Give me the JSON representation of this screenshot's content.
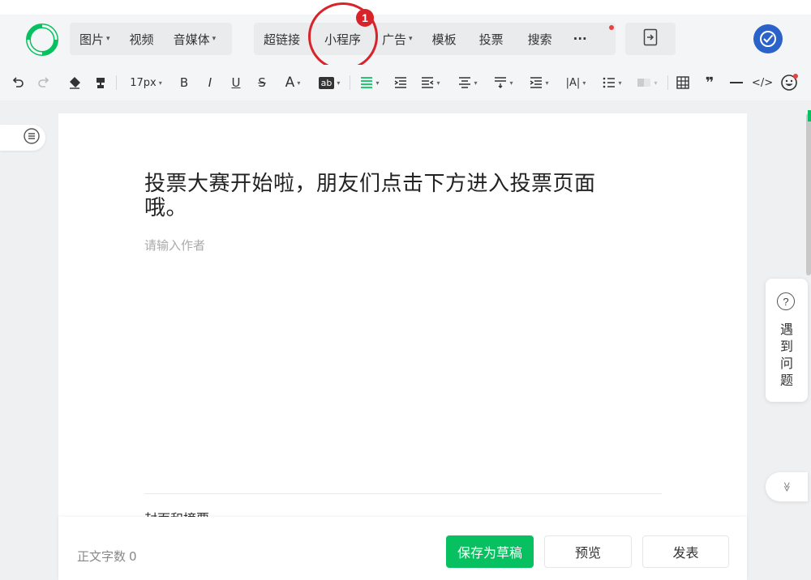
{
  "topbar": {
    "menu_left": [
      {
        "label": "图片",
        "caret": true
      },
      {
        "label": "视频",
        "caret": false
      },
      {
        "label": "音媒体",
        "caret": true
      }
    ],
    "menu_mid": [
      {
        "label": "超链接",
        "caret": false
      },
      {
        "label": "小程序",
        "caret": false
      },
      {
        "label": "广告",
        "caret": true
      },
      {
        "label": "模板",
        "caret": false
      },
      {
        "label": "投票",
        "caret": false
      },
      {
        "label": "搜索",
        "caret": false
      }
    ],
    "more_label": "···",
    "annotation_number": "1",
    "accent_color": "#07c160",
    "annotation_color": "#d8232a"
  },
  "toolbar": {
    "font_size": "17px",
    "bold": "B",
    "italic": "I",
    "underline": "U",
    "strike": "S",
    "font_color": "A",
    "highlight": "ab",
    "quote": "❞",
    "code": "</>"
  },
  "editor": {
    "title": "投票大赛开始啦，朋友们点击下方进入投票页面哦。",
    "author_placeholder": "请输入作者",
    "cover_label": "封面和摘要"
  },
  "bottom": {
    "word_count_label": "正文字数",
    "word_count_value": "0",
    "save_draft": "保存为草稿",
    "preview": "预览",
    "publish": "发表"
  },
  "help": {
    "icon_text": "?",
    "label": "遇到问题"
  },
  "scroll_icon": "≫"
}
